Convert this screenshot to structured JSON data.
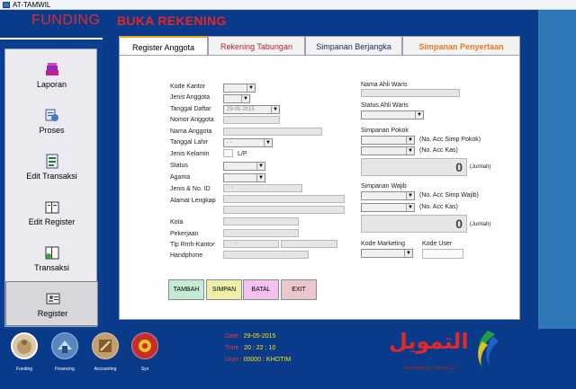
{
  "window": {
    "title": "AT-TAMWIL"
  },
  "sidebar": {
    "header": "FUNDING",
    "items": [
      {
        "label": "Laporan",
        "icon": "books-icon"
      },
      {
        "label": "Proses",
        "icon": "process-icon"
      },
      {
        "label": "Edit Transaksi",
        "icon": "edit-transaction-icon"
      },
      {
        "label": "Edit  Register",
        "icon": "edit-register-icon"
      },
      {
        "label": "Transaksi",
        "icon": "transaction-icon"
      },
      {
        "label": "Register",
        "icon": "register-icon"
      }
    ],
    "selected": "Register"
  },
  "main": {
    "title": "BUKA REKENING",
    "tabs": [
      "Register Anggota",
      "Rekening Tabungan",
      "Simpanan Berjangka",
      "Simpanan Penyertaan"
    ],
    "active_tab": "Register Anggota",
    "form": {
      "kode_kantor": "Kode Kantor",
      "jenis_anggota": "Jenis Anggota",
      "tanggal_daftar": "Tanggal Daftar",
      "tanggal_daftar_value": "29-05-2015",
      "nomor_anggota": "Nomor Anggota",
      "nama_anggota": "Nama Anggota",
      "tanggal_lahir": "Tanggal Lahir",
      "tanggal_lahir_value": "- -",
      "jenis_kelamin": "Jenis Kelamin",
      "jenis_kelamin_hint": "L/P",
      "status": "Status",
      "agama": "Agama",
      "jenis_no_id": "Jenis & No. ID",
      "jenis_no_id_value": "-",
      "alamat_lengkap": "Alamat Lengkap",
      "kota": "Kota",
      "pekerjaan": "Pekerjaan",
      "tlp_rmh_kantor": "Tlp Rmh-Kantor",
      "tlp_value": "-",
      "handphone": "Handphone",
      "nama_ahli_waris": "Nama Ahli Waris",
      "status_ahli_waris": "Status Ahli Waris",
      "simpanan_pokok": "Simpanan Pokok",
      "no_acc_simp_pokok": "(No. Acc Simp Pokok)",
      "no_acc_kas_1": "(No. Acc Kas)",
      "jumlah_pokok": "0",
      "jumlah_label_1": "(Jumlah)",
      "simpanan_wajib": "Simpanan Wajib",
      "no_acc_simp_wajib": "(No. Acc Simp Wajib)",
      "no_acc_kas_2": "(No. Acc Kas)",
      "jumlah_wajib": "0",
      "jumlah_label_2": "(Jumlah)",
      "kode_marketing": "Kode Marketing",
      "kode_user": "Kode User"
    },
    "buttons": {
      "tambah": "TAMBAH",
      "simpan": "SIMPAN",
      "batal": "BATAL",
      "exit": "EXIT"
    }
  },
  "footer": {
    "modules": [
      "Funding",
      "Financing",
      "Accounting",
      "Sys"
    ],
    "date_label": "Date :",
    "date_value": "29-05-2015",
    "time_label": "Time :",
    "time_h": "20",
    "time_m": "22",
    "time_s": "10",
    "user_label": "User :",
    "user_value": "00000 : KHOTIM",
    "logo_text": "التمويل",
    "credit": "Developed by : Dhana S.N"
  },
  "colors": {
    "accent_red": "#e82323",
    "tab_orange": "#f0a028",
    "background": "#0a3b8a"
  }
}
